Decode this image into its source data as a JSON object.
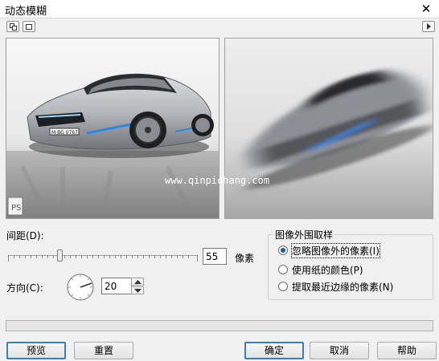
{
  "window": {
    "title": "动态模糊",
    "close_icon": "close-icon"
  },
  "toolbar": {
    "split_view_icon": "split-view-icon",
    "single_view_icon": "single-view-icon",
    "expand_icon": "play-triangle-icon"
  },
  "preview": {
    "watermark": "www.qinpichang.com",
    "plate_text": "M·BG 0767"
  },
  "distance": {
    "label": "间距(D):",
    "value": "55",
    "unit": "像素",
    "slider_level": 0.27
  },
  "direction": {
    "label": "方向(C):",
    "value": "20",
    "dial_icon": "direction-dial-icon"
  },
  "sampling": {
    "title": "图像外围取样",
    "options": [
      {
        "label": "忽略图像外的像素(I)",
        "checked": true
      },
      {
        "label": "使用纸的颜色(P)",
        "checked": false
      },
      {
        "label": "提取最近边缘的像素(N)",
        "checked": false
      }
    ]
  },
  "buttons": {
    "preview": "预览",
    "reset": "重置",
    "ok": "确定",
    "cancel": "取消",
    "help": "帮助"
  }
}
